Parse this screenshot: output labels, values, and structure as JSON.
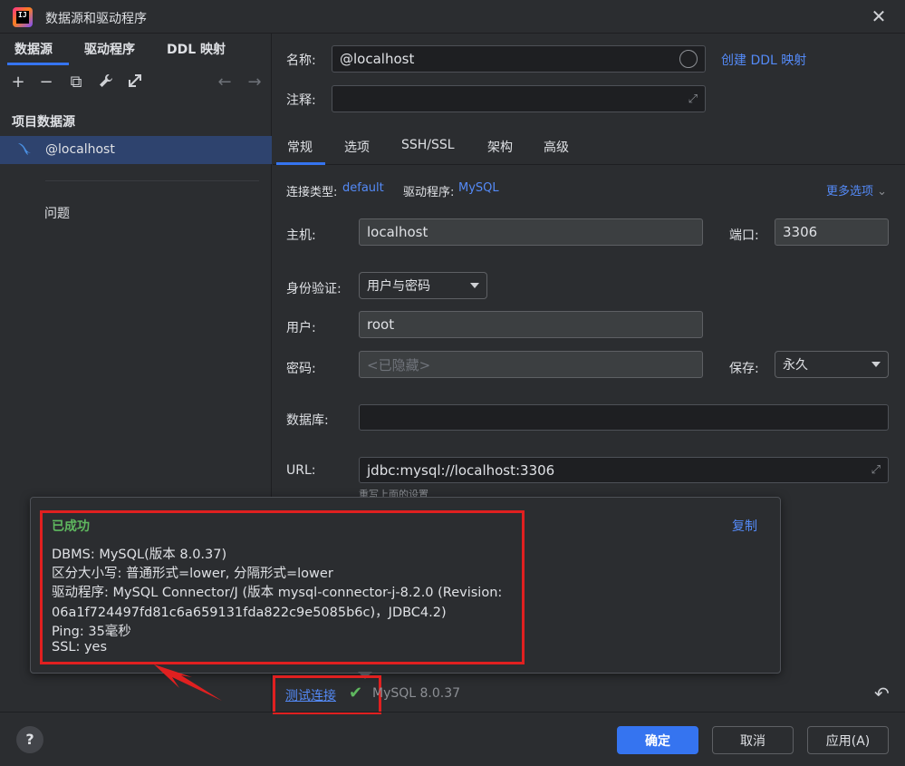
{
  "window": {
    "title": "数据源和驱动程序",
    "close_glyph": "✕"
  },
  "left": {
    "tabs": [
      "数据源",
      "驱动程序",
      "DDL 映射"
    ],
    "toolbar": {
      "add": "+",
      "remove": "−",
      "copy": "⧉",
      "wrench": "🔧",
      "export": "⇱",
      "back": "←",
      "forward": "→"
    },
    "section_title": "项目数据源",
    "selected_item": "@localhost",
    "problems": "问题"
  },
  "form": {
    "name_label": "名称:",
    "name_value": "@localhost",
    "create_ddl_link": "创建 DDL 映射",
    "comment_label": "注释:",
    "comment_value": "",
    "tabs": [
      "常规",
      "选项",
      "SSH/SSL",
      "架构",
      "高级"
    ],
    "conn_type_label": "连接类型:",
    "conn_type_value": "default",
    "driver_label": "驱动程序:",
    "driver_value": "MySQL",
    "more_options": "更多选项",
    "host_label": "主机:",
    "host_value": "localhost",
    "port_label": "端口:",
    "port_value": "3306",
    "auth_label": "身份验证:",
    "auth_value": "用户与密码",
    "user_label": "用户:",
    "user_value": "root",
    "password_label": "密码:",
    "password_placeholder": "<已隐藏>",
    "save_label": "保存:",
    "save_value": "永久",
    "database_label": "数据库:",
    "database_value": "",
    "url_label": "URL:",
    "url_value": "jdbc:mysql://localhost:3306",
    "url_hint": "重写上面的设置"
  },
  "popup": {
    "status": "已成功",
    "copy_link": "复制",
    "lines": [
      "DBMS: MySQL(版本 8.0.37)",
      "区分大小写: 普通形式=lower, 分隔形式=lower",
      "驱动程序: MySQL Connector/J (版本 mysql-connector-j-8.2.0 (Revision:",
      "06a1f724497fd81c6a659131fda822c9e5085b6c)，JDBC4.2)",
      "Ping: 35毫秒",
      "SSL: yes"
    ]
  },
  "bottom": {
    "test_connection": "测试连接",
    "mysql_version": "MySQL 8.0.37",
    "help": "?",
    "ok": "确定",
    "cancel": "取消",
    "apply": "应用(A)"
  },
  "colors": {
    "accent": "#3574f0",
    "link": "#548af7",
    "success": "#5fb85f",
    "highlight_red": "#e02020"
  }
}
